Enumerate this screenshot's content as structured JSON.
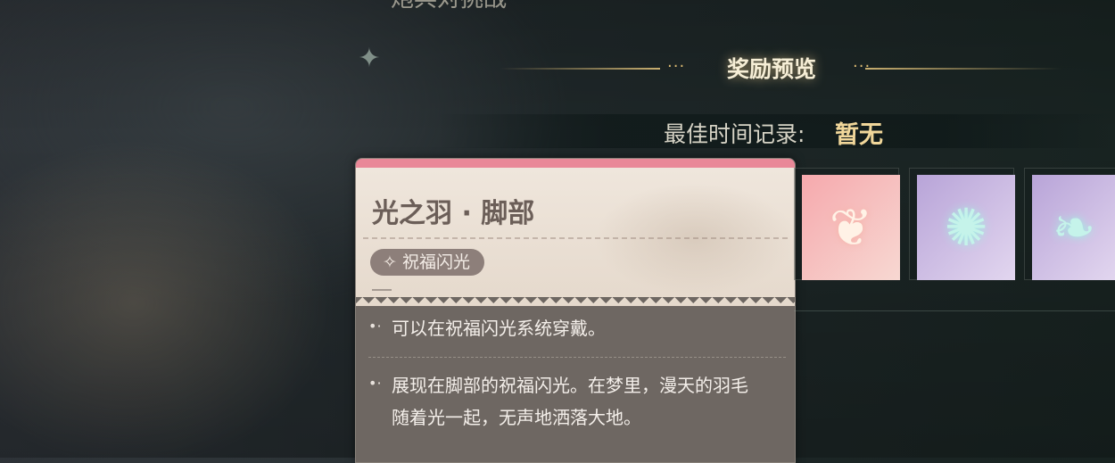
{
  "header": {
    "cut_text": "炮兵对挑战",
    "reward_title": "奖励预览",
    "dots": "···"
  },
  "best_record": {
    "label": "最佳时间记录:",
    "value": "暂无"
  },
  "item_card": {
    "name": "光之羽 · 脚部",
    "tag": "祝福闪光",
    "tag_icon": "sparkle-icon",
    "bullet": "•·",
    "descriptions": [
      "可以在祝福闪光系统穿戴。",
      "展现在脚部的祝福闪光。在梦里，漫天的羽毛",
      "随着光一起，无声地洒落大地。"
    ],
    "accent_color": "#e98898"
  },
  "reward_thumbs": [
    {
      "icon": "feather-icon",
      "glyph": "❦",
      "rarity_color": "#f6a9ad"
    },
    {
      "icon": "dandelion-icon",
      "glyph": "✺",
      "rarity_color": "#b8a4d8"
    },
    {
      "icon": "firefly-icon",
      "glyph": "❧",
      "rarity_color": "#b8a4d8"
    }
  ]
}
